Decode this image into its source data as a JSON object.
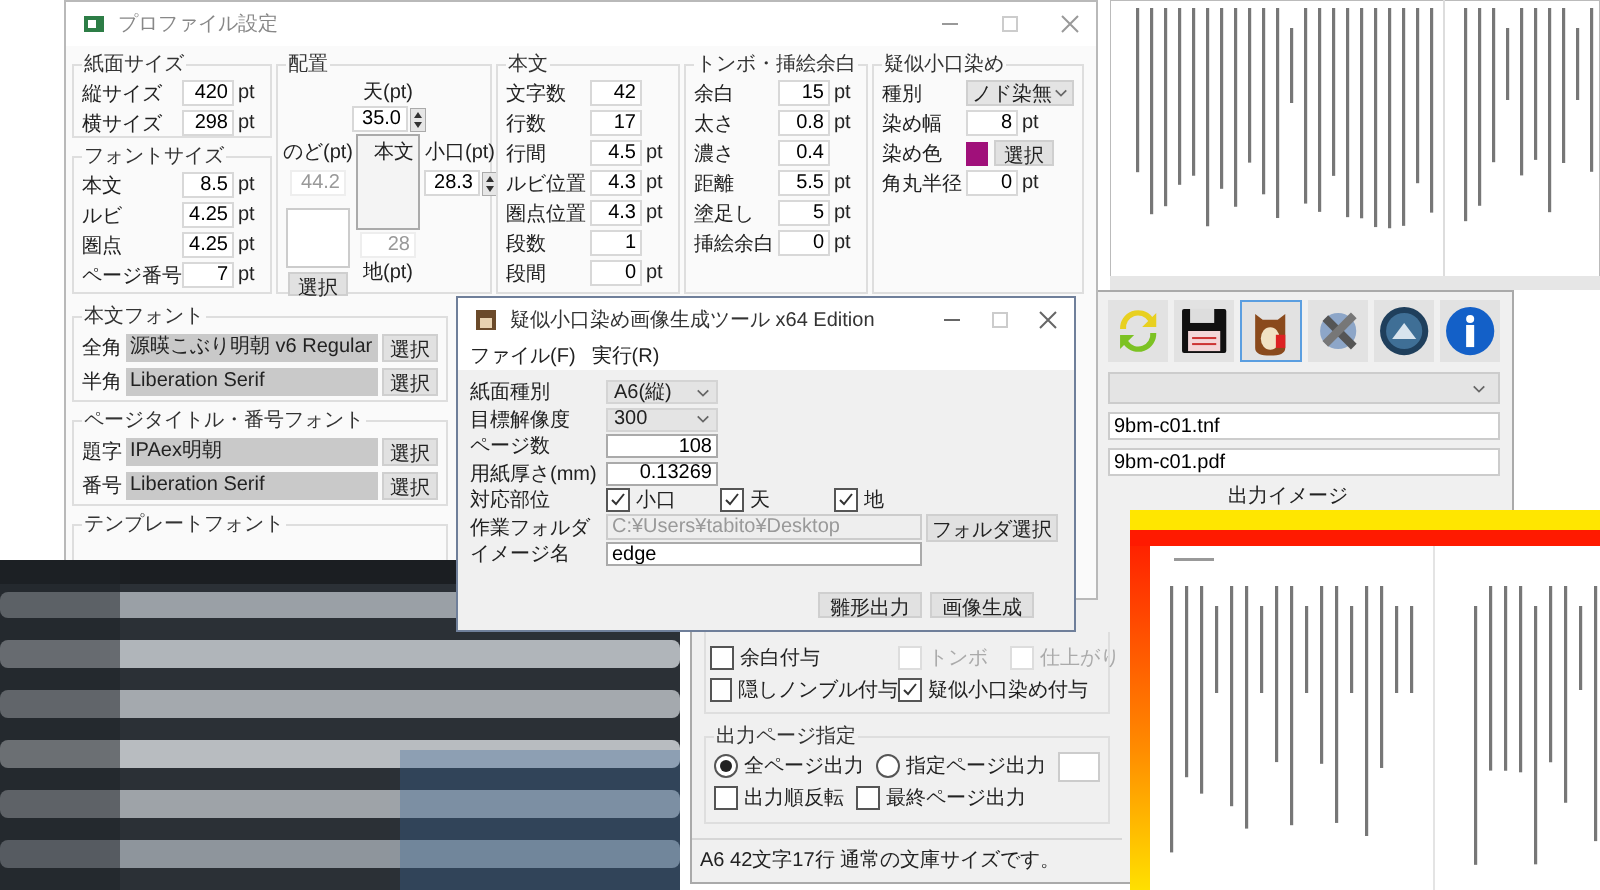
{
  "profile_window": {
    "title": "プロファイル設定",
    "paper_size": {
      "label": "紙面サイズ",
      "rows": [
        {
          "label": "縦サイズ",
          "value": "420",
          "unit": "pt"
        },
        {
          "label": "横サイズ",
          "value": "298",
          "unit": "pt"
        }
      ]
    },
    "font_size": {
      "label": "フォントサイズ",
      "rows": [
        {
          "label": "本文",
          "value": "8.5",
          "unit": "pt"
        },
        {
          "label": "ルビ",
          "value": "4.25",
          "unit": "pt"
        },
        {
          "label": "圏点",
          "value": "4.25",
          "unit": "pt"
        },
        {
          "label": "ページ番号",
          "value": "7",
          "unit": "pt"
        }
      ]
    },
    "layout": {
      "label": "配置",
      "top_label": "天(pt)",
      "top_value": "35.0",
      "body_label": "本文",
      "gutter_label": "のど(pt)",
      "gutter_value": "44.2",
      "fore_edge_label": "小口(pt)",
      "fore_edge_value": "28.3",
      "bottom_value": "28",
      "bottom_label": "地(pt)",
      "select_button": "選択"
    },
    "body": {
      "label": "本文",
      "rows": [
        {
          "label": "文字数",
          "value": "42"
        },
        {
          "label": "行数",
          "value": "17"
        },
        {
          "label": "行間",
          "value": "4.5",
          "unit": "pt"
        },
        {
          "label": "ルビ位置",
          "value": "4.3",
          "unit": "pt"
        },
        {
          "label": "圏点位置",
          "value": "4.3",
          "unit": "pt"
        },
        {
          "label": "段数",
          "value": "1"
        },
        {
          "label": "段間",
          "value": "0",
          "unit": "pt"
        }
      ]
    },
    "trim": {
      "label": "トンボ・挿絵余白",
      "rows": [
        {
          "label": "余白",
          "value": "15",
          "unit": "pt"
        },
        {
          "label": "太さ",
          "value": "0.8",
          "unit": "pt"
        },
        {
          "label": "濃さ",
          "value": "0.4"
        },
        {
          "label": "距離",
          "value": "5.5",
          "unit": "pt"
        },
        {
          "label": "塗足し",
          "value": "5",
          "unit": "pt"
        },
        {
          "label": "挿絵余白",
          "value": "0",
          "unit": "pt"
        }
      ]
    },
    "edge_dye": {
      "label": "疑似小口染め",
      "type_label": "種別",
      "type_value": "ノド染無",
      "width_label": "染め幅",
      "width_value": "8",
      "width_unit": "pt",
      "color_label": "染め色",
      "color": "#a0107a",
      "color_button": "選択",
      "radius_label": "角丸半径",
      "radius_value": "0",
      "radius_unit": "pt"
    },
    "body_font": {
      "label": "本文フォント",
      "rows": [
        {
          "label": "全角",
          "value": "源暎こぶり明朝 v6 Regular",
          "button": "選択"
        },
        {
          "label": "半角",
          "value": "Liberation Serif",
          "button": "選択"
        }
      ]
    },
    "title_font": {
      "label": "ページタイトル・番号フォント",
      "rows": [
        {
          "label": "題字",
          "value": "IPAex明朝",
          "button": "選択"
        },
        {
          "label": "番号",
          "value": "Liberation Serif",
          "button": "選択"
        }
      ]
    },
    "template_font": {
      "label": "テンプレートフォント"
    }
  },
  "generator_dialog": {
    "title": "疑似小口染め画像生成ツール x64 Edition",
    "menu": [
      "ファイル(F)",
      "実行(R)"
    ],
    "rows": [
      {
        "kind": "select",
        "label": "紙面種別",
        "value": "A6(縦)"
      },
      {
        "kind": "select",
        "label": "目標解像度",
        "value": "300"
      },
      {
        "kind": "number",
        "label": "ページ数",
        "value": "108"
      },
      {
        "kind": "number",
        "label": "用紙厚さ(mm)",
        "value": "0.13269"
      },
      {
        "kind": "checks",
        "label": "対応部位",
        "options": [
          {
            "label": "小口",
            "checked": true
          },
          {
            "label": "天",
            "checked": true
          },
          {
            "label": "地",
            "checked": true
          }
        ]
      },
      {
        "kind": "folder",
        "label": "作業フォルダ",
        "value": "C:¥Users¥tabito¥Desktop",
        "disabled": true,
        "button": "フォルダ選択"
      },
      {
        "kind": "text",
        "label": "イメージ名",
        "value": "edge"
      }
    ],
    "buttons": [
      "雛形出力",
      "画像生成"
    ]
  },
  "main_window": {
    "files": [
      "9bm-c01.tnf",
      "9bm-c01.pdf"
    ],
    "preview_label": "出力イメージ",
    "margin_checks": [
      {
        "label": "余白付与",
        "checked": false,
        "disabled": false
      },
      {
        "label": "トンボ",
        "checked": false,
        "disabled": true
      },
      {
        "label": "仕上がり",
        "checked": false,
        "disabled": true
      },
      {
        "label": "隠しノンブル付与",
        "checked": false,
        "disabled": false
      },
      {
        "label": "疑似小口染め付与",
        "checked": true,
        "disabled": false
      }
    ],
    "output_pages": {
      "label": "出力ページ指定",
      "radios": [
        {
          "label": "全ページ出力",
          "selected": true
        },
        {
          "label": "指定ページ出力",
          "selected": false
        }
      ],
      "checks": [
        {
          "label": "出力順反転",
          "checked": false
        },
        {
          "label": "最終ページ出力",
          "checked": false
        }
      ]
    },
    "status": "A6 42文字17行 通常の文庫サイズです。"
  }
}
